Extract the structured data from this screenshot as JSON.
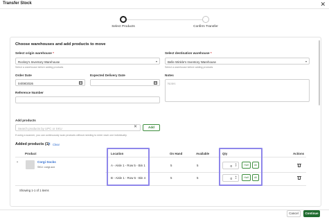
{
  "dialog": {
    "title": "Transfer Stock",
    "close_glyph": "✕"
  },
  "stepper": {
    "steps": [
      {
        "label": "Select Products",
        "state": "active"
      },
      {
        "label": "Confirm Transfer",
        "state": "inactive"
      }
    ]
  },
  "form": {
    "section_title": "Choose warehouses and add products to move",
    "origin": {
      "label": "Select origin warehouse",
      "required_mark": "*",
      "value": "Rocksy's Inventory Warehouse",
      "help": "Select a warehouse before adding products"
    },
    "destination": {
      "label": "Select destination warehouse",
      "required_mark": "*",
      "value": "Belle Winkle's Inventory Warehouse",
      "help": "Select a warehouse before adding products"
    },
    "order_date": {
      "label": "Order Date",
      "value": "04/08/2026"
    },
    "expected_delivery": {
      "label": "Expected Delivery Date",
      "value": ""
    },
    "notes": {
      "label": "Notes",
      "placeholder": "Notes"
    },
    "reference": {
      "label": "Reference Number",
      "value": ""
    }
  },
  "add_products": {
    "label": "Add products",
    "placeholder": "Search products by UPC or SKU",
    "add_button": "Add",
    "help": "If using a scanner, you can continuously scan products without needing to enter each one individually."
  },
  "added": {
    "title": "Added products (1)",
    "clear_label": "Clear",
    "columns": [
      "Product",
      "Location",
      "On Hand",
      "Available",
      "Qty",
      "Actions"
    ],
    "product": {
      "name": "Corgi Socks",
      "sku": "SKU: corgi-sox"
    },
    "rows": [
      {
        "location": "A - Aisle 1 - Row 5 - Bin 1",
        "on_hand": "5",
        "available": "5",
        "qty": "0"
      },
      {
        "location": "B - Aisle 1 - Row 5 - Bin 4",
        "on_hand": "5",
        "available": "5",
        "qty": "0"
      }
    ],
    "qty_buttons": {
      "half": "Half",
      "all": "All"
    },
    "showing": "Showing 1-1 of 1 items"
  },
  "footer": {
    "cancel": "Cancel",
    "continue": "Continue"
  },
  "colors": {
    "accent_green": "#1f6b2f",
    "highlight": "#8e86ea",
    "link": "#2f6ccf",
    "required": "#d83a3a"
  }
}
